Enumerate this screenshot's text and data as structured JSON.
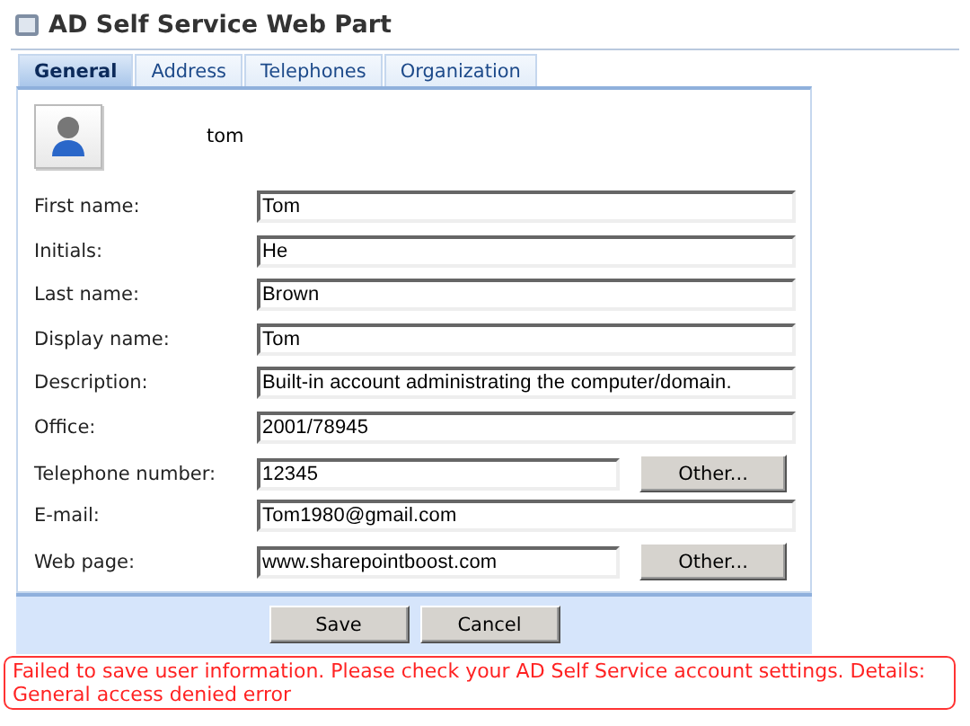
{
  "title": "AD Self Service Web Part",
  "tabs": [
    {
      "label": "General",
      "selected": true
    },
    {
      "label": "Address",
      "selected": false
    },
    {
      "label": "Telephones",
      "selected": false
    },
    {
      "label": "Organization",
      "selected": false
    }
  ],
  "user": {
    "name": "tom"
  },
  "fields": [
    {
      "label": "First name:",
      "value": "Tom"
    },
    {
      "label": "Initials:",
      "value": "He"
    },
    {
      "label": "Last name:",
      "value": "Brown"
    },
    {
      "label": "Display name:",
      "value": "Tom"
    },
    {
      "label": "Description:",
      "value": "Built-in account administrating the computer/domain."
    },
    {
      "label": "Office:",
      "value": "2001/78945"
    },
    {
      "label": "Telephone number:",
      "value": "12345",
      "button": "Other..."
    },
    {
      "label": "E-mail:",
      "value": "Tom1980@gmail.com"
    },
    {
      "label": "Web page:",
      "value": "www.sharepointboost.com",
      "button": "Other..."
    }
  ],
  "buttons": [
    "Save",
    "Cancel"
  ],
  "error": "Failed to save user information. Please check your AD Self Service account settings. Details: General access denied error"
}
